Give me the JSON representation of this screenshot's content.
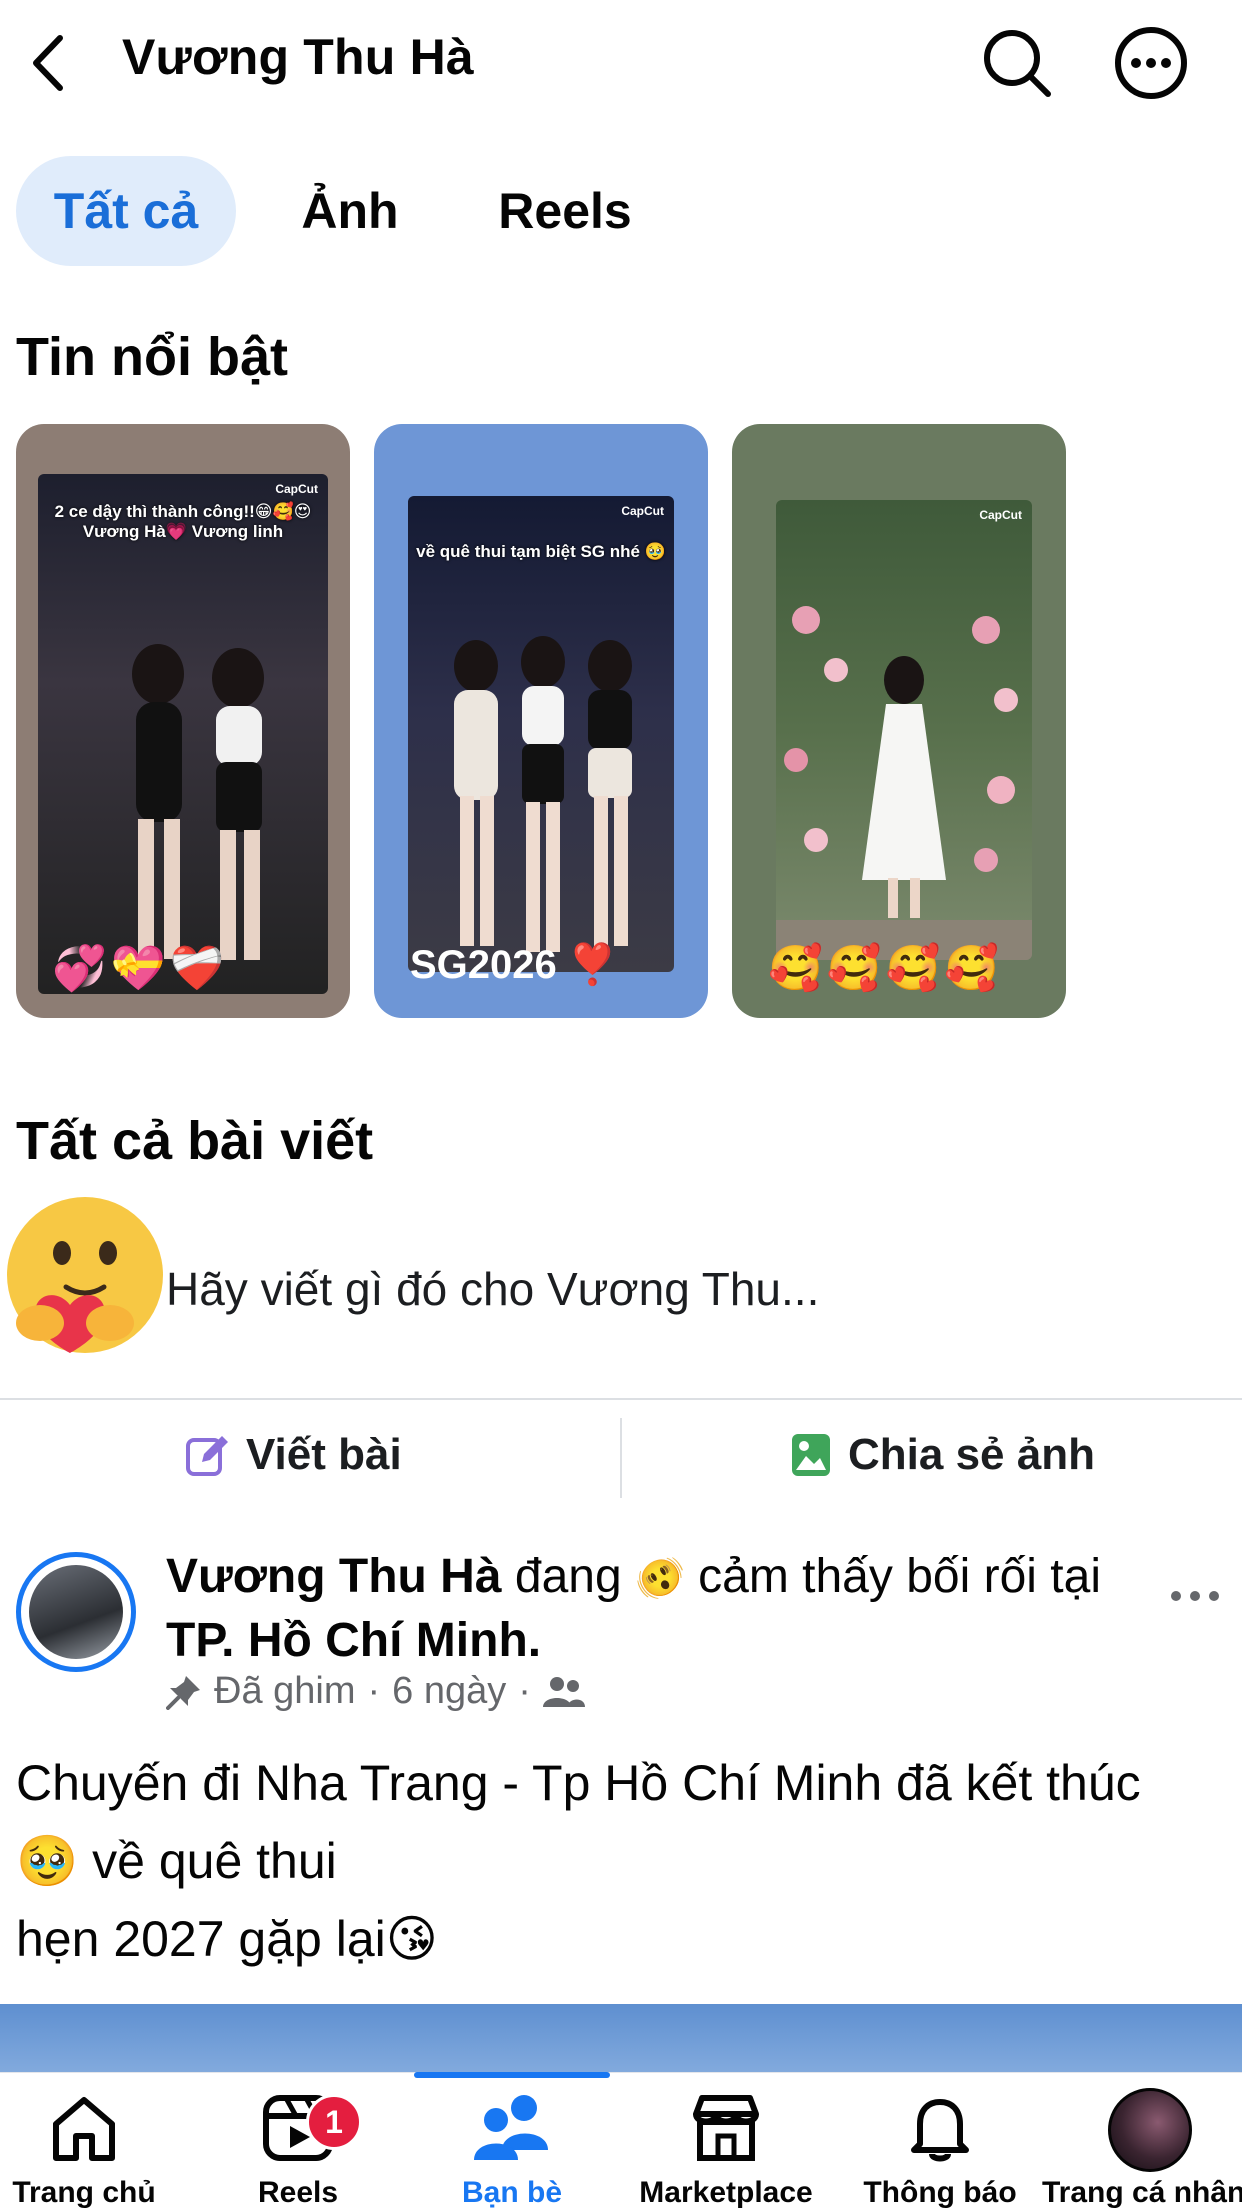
{
  "header": {
    "title": "Vương Thu Hà"
  },
  "tabs": [
    {
      "label": "Tất cả",
      "active": true
    },
    {
      "label": "Ảnh",
      "active": false
    },
    {
      "label": "Reels",
      "active": false
    }
  ],
  "highlights": {
    "title": "Tin nổi bật",
    "stories": [
      {
        "caption": "2 ce dậy thì thành công!!😁🥰😍\nVương Hà💗 Vương linh",
        "brand": "CapCut",
        "overlay": "💞💝❤️‍🩹",
        "bg": "#8d7d74"
      },
      {
        "caption": "về quê thui tạm biệt SG nhé 🥹",
        "brand": "CapCut",
        "overlay": "SG2026 ❣️",
        "bg": "#6e96d6"
      },
      {
        "caption": "",
        "brand": "CapCut",
        "overlay": "🥰🥰🥰🥰",
        "bg": "#6a7a60"
      }
    ]
  },
  "all_posts": {
    "title": "Tất cả bài viết",
    "composer_placeholder": "Hãy viết gì đó cho Vương Thu...",
    "write_label": "Viết bài",
    "share_photo_label": "Chia sẻ ảnh"
  },
  "post": {
    "author": "Vương Thu Hà",
    "verb": " đang ",
    "feeling_emoji": "🫨",
    "feeling": " cảm thấy bối rối tại ",
    "location": "TP. Hồ Chí Minh.",
    "pinned": "Đã ghim",
    "age": "6 ngày",
    "line1": "Chuyến đi Nha Trang - Tp Hồ Chí Minh đã kết thúc",
    "line2": "🥹 về quê thui",
    "line3": "hẹn 2027 gặp lại😘"
  },
  "nav": [
    {
      "label": "Trang chủ"
    },
    {
      "label": "Reels",
      "badge": "1"
    },
    {
      "label": "Bạn bè",
      "active": true
    },
    {
      "label": "Marketplace"
    },
    {
      "label": "Thông báo"
    },
    {
      "label": "Trang cá nhân"
    }
  ],
  "colors": {
    "accent": "#1877f2",
    "badge": "#e41e3f",
    "tab_active_bg": "#e0ecfb"
  }
}
